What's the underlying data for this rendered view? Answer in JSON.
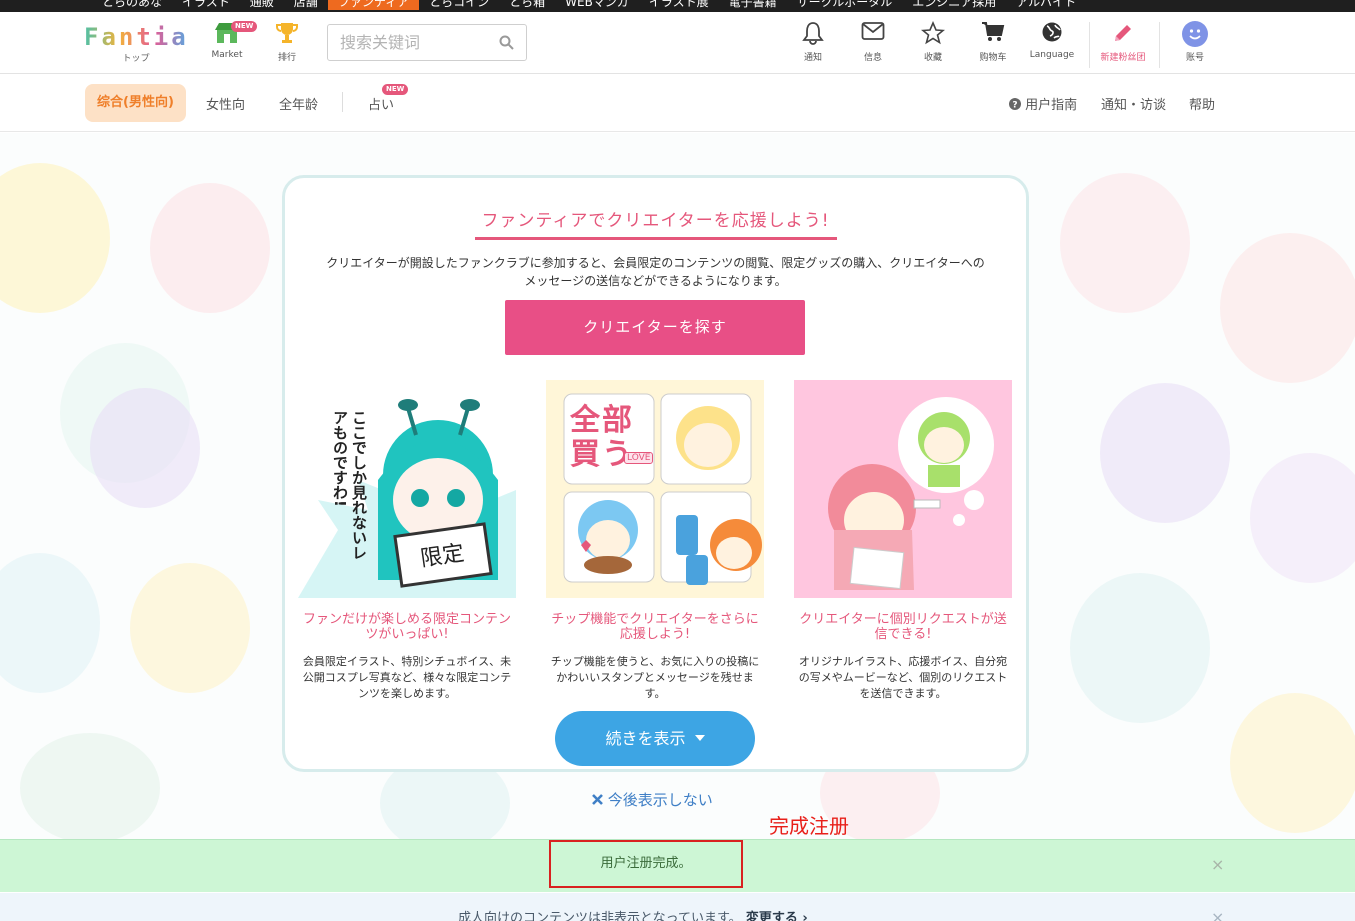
{
  "topbar": {
    "links": [
      "とらのあな",
      "イラスト",
      "通販",
      "店舗",
      "ファンティア",
      "とらコイン",
      "とら箱",
      "WEBマンガ",
      "イラスト展",
      "電子書籍",
      "サークルポータル",
      "エンジニア採用",
      "アルバイト"
    ],
    "active_index": 4
  },
  "header": {
    "logo_text": "Fantia",
    "logo_sub": "トップ",
    "market_label": "Market",
    "market_badge": "NEW",
    "ranking_label": "排行",
    "search_placeholder": "搜索关键词",
    "icons": {
      "notify": "通知",
      "message": "信息",
      "favorite": "收藏",
      "cart": "购物车",
      "language": "Language",
      "create_fanclub": "新建粉丝团",
      "account": "账号"
    }
  },
  "catbar": {
    "active": "综合(男性向)",
    "female": "女性向",
    "allages": "全年龄",
    "fortune": "占い",
    "fortune_badge": "NEW",
    "guide": "用户指南",
    "notify_visit": "通知・访谈",
    "help": "帮助"
  },
  "card": {
    "title": "ファンティアでクリエイターを応援しよう!",
    "desc": "クリエイターが開設したファンクラブに参加すると、会員限定のコンテンツの閲覧、限定グッズの購入、クリエイターへのメッセージの送信などができるようになります。",
    "find_button": "クリエイターを探す",
    "features": [
      {
        "title": "ファンだけが楽しめる限定コンテンツがいっぱい!",
        "desc": "会員限定イラスト、特別シチュボイス、未公開コスプレ写真など、様々な限定コンテンツを楽しめます。",
        "img_text": "ここでしか見れないレアものですわ!",
        "sign_text": "限定"
      },
      {
        "title": "チップ機能でクリエイターをさらに応援しよう!",
        "desc": "チップ機能を使うと、お気に入りの投稿にかわいいスタンプとメッセージを残せます。",
        "sticker_text": "全部買う",
        "love_text": "LOVE"
      },
      {
        "title": "クリエイターに個別リクエストが送信できる!",
        "desc": "オリジナルイラスト、応援ボイス、自分宛の写メやムービーなど、個別のリクエストを送信できます。"
      }
    ],
    "more_button": "続きを表示"
  },
  "dismiss_text": "今後表示しない",
  "annotation_text": "完成注册",
  "notice": {
    "message": "用户注册完成。",
    "close": "×"
  },
  "notice2": {
    "message": "成人向けのコンテンツは非表示となっています。",
    "link": "変更する ›",
    "close": "×"
  },
  "colors": {
    "brand_pink": "#e5577b",
    "find_button": "#e84f86",
    "more_button": "#3da5e4",
    "active_pill_bg": "#fde1c6",
    "active_pill_text": "#ef7f2a",
    "notice_bg": "#cdf6d5",
    "annotation_red": "#e8201a"
  }
}
